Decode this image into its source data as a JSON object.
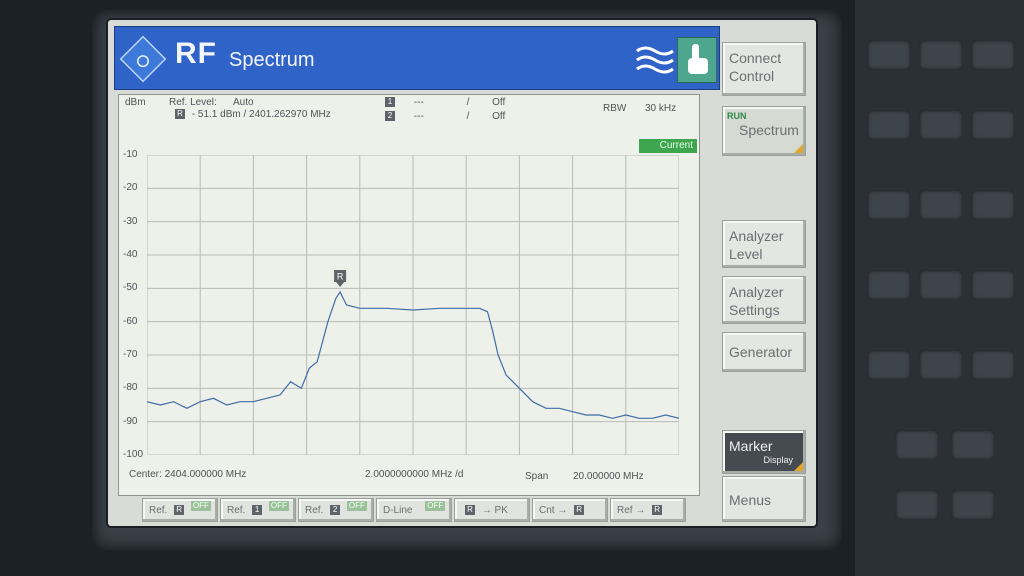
{
  "title_bar": {
    "brand": "RF",
    "app_name": "Spectrum"
  },
  "softkeys": {
    "connect_control": "Connect Control",
    "run_label": "RUN",
    "spectrum": "Spectrum",
    "analyzer_level": "Analyzer Level",
    "analyzer_settings": "Analyzer Settings",
    "generator": "Generator",
    "marker": "Marker",
    "marker_sub": "Display",
    "menus": "Menus"
  },
  "header": {
    "unit": "dBm",
    "ref_level_label": "Ref. Level:",
    "ref_level_value": "Auto",
    "marker_r_icon": "R",
    "marker_r_readout": "- 51.1  dBm /   2401.262970   MHz",
    "marker1_icon": "1",
    "marker1_value": "---",
    "marker1_sep": "/",
    "marker1_state": "Off",
    "marker2_icon": "2",
    "marker2_value": "---",
    "marker2_sep": "/",
    "marker2_state": "Off",
    "rbw_label": "RBW",
    "rbw_value": "30 kHz",
    "trace_badge": "Current"
  },
  "y_axis_labels": [
    "-10",
    "-20",
    "-30",
    "-40",
    "-50",
    "-60",
    "-70",
    "-80",
    "-90",
    "-100"
  ],
  "footer": {
    "center": "Center:  2404.000000  MHz",
    "div": "2.0000000000 MHz  /d",
    "span_label": "Span",
    "span_value": "20.000000  MHz"
  },
  "bottom_keys": {
    "ref_r_label": "Ref.",
    "ref_r_icon": "R",
    "ref_1_label": "Ref.",
    "ref_1_icon": "1",
    "ref_2_label": "Ref.",
    "ref_2_icon": "2",
    "dline_label": "D-Line",
    "off_tag": "OFF",
    "r_to_pk_icon": "R",
    "r_to_pk_label": "→  PK",
    "cnt_label": "Cnt  →",
    "cnt_icon": "R",
    "ref_to_label": "Ref  →",
    "ref_to_icon": "R"
  },
  "chart_data": {
    "type": "line",
    "xlabel": "",
    "ylabel": "dBm",
    "xlim": [
      2394.0,
      2414.0
    ],
    "ylim": [
      -100,
      -10
    ],
    "grid": true,
    "marker": {
      "name": "R",
      "x": 2401.26,
      "y": -51.1
    },
    "series": [
      {
        "x": [
          2394.0,
          2394.5,
          2395.0,
          2395.5,
          2396.0,
          2396.5,
          2397.0,
          2397.5,
          2398.0,
          2398.5,
          2399.0,
          2399.4,
          2399.8,
          2400.1,
          2400.4,
          2400.8,
          2401.1,
          2401.26,
          2401.5,
          2402.0,
          2403.0,
          2404.0,
          2405.0,
          2406.0,
          2406.5,
          2406.8,
          2407.0,
          2407.2,
          2407.5,
          2408.0,
          2408.5,
          2409.0,
          2409.5,
          2410.0,
          2410.5,
          2411.0,
          2411.5,
          2412.0,
          2412.5,
          2413.0,
          2413.5,
          2414.0
        ],
        "y": [
          -84,
          -85,
          -84,
          -86,
          -84,
          -83,
          -85,
          -84,
          -84,
          -83,
          -82,
          -78,
          -80,
          -74,
          -72,
          -60,
          -53,
          -51.1,
          -55,
          -56,
          -56,
          -56.5,
          -56,
          -56,
          -56,
          -57,
          -63,
          -70,
          -76,
          -80,
          -84,
          -86,
          -86,
          -87,
          -88,
          -88,
          -89,
          -88,
          -89,
          -89,
          -88,
          -89
        ]
      }
    ]
  }
}
